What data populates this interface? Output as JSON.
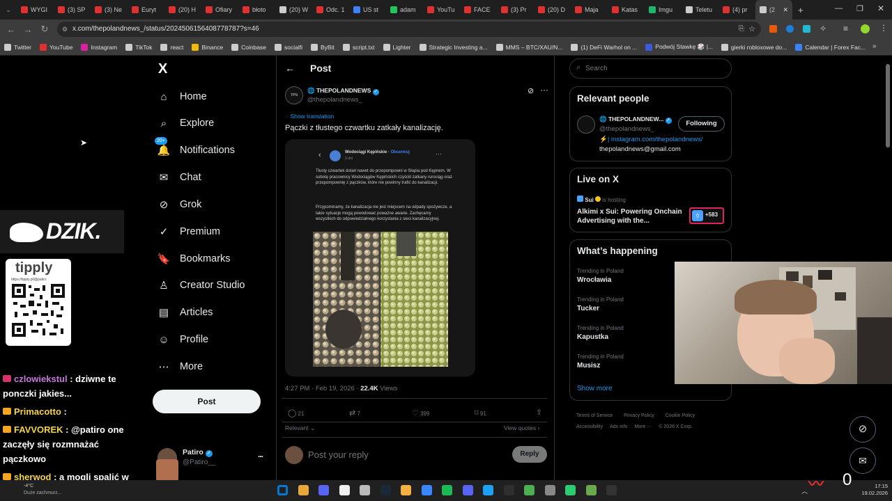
{
  "browser": {
    "tabs": [
      {
        "label": "WYGI",
        "color": "#e03131"
      },
      {
        "label": "(3) SP",
        "color": "#e03131"
      },
      {
        "label": "(3) Ne",
        "color": "#e03131"
      },
      {
        "label": "Euryt",
        "color": "#e03131"
      },
      {
        "label": "(20) H",
        "color": "#e03131"
      },
      {
        "label": "Ofiary",
        "color": "#e03131"
      },
      {
        "label": "błoto",
        "color": "#e03131"
      },
      {
        "label": "(20) W",
        "color": "#cccccc"
      },
      {
        "label": "Odc. 1",
        "color": "#e03131"
      },
      {
        "label": "US st",
        "color": "#3b82f6"
      },
      {
        "label": "adam",
        "color": "#22c55e"
      },
      {
        "label": "YouTu",
        "color": "#e03131"
      },
      {
        "label": "FACE",
        "color": "#e03131"
      },
      {
        "label": "(3) Pr",
        "color": "#e03131"
      },
      {
        "label": "(20) D",
        "color": "#e03131"
      },
      {
        "label": "Maja",
        "color": "#e03131"
      },
      {
        "label": "Katas",
        "color": "#e03131"
      },
      {
        "label": "Imgu",
        "color": "#1bb76e"
      },
      {
        "label": "Teletu",
        "color": "#cccccc"
      },
      {
        "label": "(4) pr",
        "color": "#e03131"
      },
      {
        "label": "(2",
        "color": "#cccccc"
      }
    ],
    "new_tab": "+",
    "url": "x.com/thepolandnews_/status/2024506156408778787?s=46",
    "bookmarks": [
      {
        "label": "Twitter",
        "color": "#cccccc"
      },
      {
        "label": "YouTube",
        "color": "#e03131"
      },
      {
        "label": "Instagram",
        "color": "#d6249f"
      },
      {
        "label": "TikTok",
        "color": "#cccccc"
      },
      {
        "label": "react",
        "color": "#cccccc"
      },
      {
        "label": "Binance",
        "color": "#f0b90b"
      },
      {
        "label": "Coinbase",
        "color": "#cccccc"
      },
      {
        "label": "socialfi",
        "color": "#cccccc"
      },
      {
        "label": "ByBit",
        "color": "#cccccc"
      },
      {
        "label": "script.txt",
        "color": "#cccccc"
      },
      {
        "label": "Lighter",
        "color": "#cccccc"
      },
      {
        "label": "Strategic Investing a...",
        "color": "#cccccc"
      },
      {
        "label": "MMS – BTC/XAU/N...",
        "color": "#cccccc"
      },
      {
        "label": "(1) DeFi Warhol on ...",
        "color": "#cccccc"
      },
      {
        "label": "Podwój Stawkę 🎲 |...",
        "color": "#3b5bdb"
      },
      {
        "label": "gierki robloxowe do...",
        "color": "#cccccc"
      },
      {
        "label": "Calendar | Forex Fac...",
        "color": "#3b82f6"
      }
    ]
  },
  "nav": {
    "logo": "X",
    "items": [
      {
        "label": "Home"
      },
      {
        "label": "Explore"
      },
      {
        "label": "Notifications",
        "badge": "20+"
      },
      {
        "label": "Chat"
      },
      {
        "label": "Grok"
      },
      {
        "label": "Premium"
      },
      {
        "label": "Bookmarks"
      },
      {
        "label": "Creator Studio"
      },
      {
        "label": "Articles"
      },
      {
        "label": "Profile"
      },
      {
        "label": "More"
      }
    ],
    "post_button": "Post",
    "account": {
      "name": "Patiro",
      "handle": "@Patiro__",
      "more": "..."
    }
  },
  "post": {
    "header": "Post",
    "author_name": "THEPOLANDNEWS",
    "author_handle": "@thepolandnews_",
    "show_translation": "Show translation",
    "text": "Pączki z tłustego czwartku zatkały kanalizację.",
    "embedded": {
      "account": "Wodociągi Kępińskie",
      "follow": "Obserwuj",
      "time": "2 dni",
      "paragraph1": "Tłusty czwartek dotarł nawet do przepompowni w Słupia pod Kępnem. W sobotę pracownicy Wodociągów Kępińskich czyścili zatkany rurociąg oraz przepompownię z pączków, które nie powinny trafić do kanalizacji.",
      "paragraph2": "Przypominamy, że kanalizacja nie jest miejscem na odpady spożywcze, a takie sytuacje mogą powodować poważne awarie. Zachęcamy wszystkich do odpowiedzialnego korzystania z sieci kanalizacyjnej."
    },
    "meta": "4:27 PM · Feb 19, 2026 · ",
    "views": "22.4K",
    "views_label": " Views",
    "stats": {
      "replies": "21",
      "reposts": "7",
      "likes": "399",
      "bookmarks": "91"
    },
    "sort": "Relevant",
    "view_quotes": "View quotes",
    "reply_placeholder": "Post your reply",
    "reply_button": "Reply"
  },
  "right": {
    "search_placeholder": "Search",
    "relevant_title": "Relevant people",
    "person": {
      "name": "THEPOLANDNEW...",
      "handle": "@thepolandnews_",
      "follow_label": "Following",
      "bio_link": "⚡| instagram.com/thepolandnews/",
      "bio_email": "thepolandnews@gmail.com"
    },
    "live_title": "Live on X",
    "live": {
      "host": "Sui",
      "hosting": " is hosting",
      "title": "Alkimi x Sui: Powering Onchain Advertising with the...",
      "count": "+583"
    },
    "happening_title": "What’s happening",
    "trends": [
      {
        "context": "Trending in Poland",
        "name": "Wrocławia"
      },
      {
        "context": "Trending in Poland",
        "name": "Tucker"
      },
      {
        "context": "Trending in Poland",
        "name": "Kapustka"
      },
      {
        "context": "Trending in Poland",
        "name": "Musisz"
      }
    ],
    "show_more": "Show more",
    "footer1": [
      "Terms of Service",
      "Privacy Policy",
      "Cookie Policy"
    ],
    "footer2": [
      "Accessibility",
      "Ads info",
      "More ···",
      "© 2026 X Corp."
    ]
  },
  "overlay": {
    "dzik": "DZIK.",
    "tipply": "tipply",
    "tipply_url": "https://tipply.pl/@patiro",
    "chat": [
      {
        "user": "czlowiekstul",
        "color": "#c678dd",
        "text": " : dziwne te ponczki jakies..."
      },
      {
        "user": "Primacotto",
        "color": "#f5d547",
        "text": " : "
      },
      {
        "user": "FAVVOREK",
        "color": "#f5d547",
        "text": " : @patiro one zaczęły się rozmnażać pączkowo"
      },
      {
        "user": "sherwod",
        "color": "#f5d547",
        "text": " : a mogli spalić w saunie"
      }
    ],
    "weather_temp": "-4°C",
    "weather_text": "Duże zachmurz...",
    "x5": "X5",
    "counter": "0"
  },
  "taskbar": {
    "time": "17:15",
    "date": "19.02.2026"
  }
}
